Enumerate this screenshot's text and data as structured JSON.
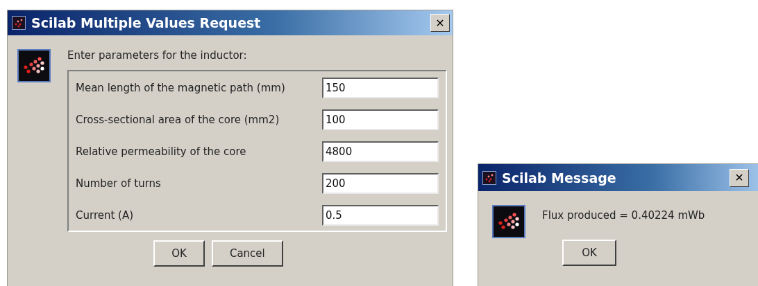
{
  "dialogs": [
    {
      "kind": "form",
      "title": "Scilab Multiple Values Request",
      "close": "✕",
      "prompt": "Enter parameters for the inductor:",
      "fields": [
        {
          "label": "Mean length of the magnetic path (mm)",
          "value": "150"
        },
        {
          "label": "Cross-sectional area of the core (mm2)",
          "value": "100"
        },
        {
          "label": "Relative permeability of the core",
          "value": "4800"
        },
        {
          "label": "Number of turns",
          "value": "200"
        },
        {
          "label": "Current (A)",
          "value": "0.5"
        }
      ],
      "buttons": [
        "OK",
        "Cancel"
      ]
    },
    {
      "kind": "message",
      "title": "Scilab Message",
      "close": "✕",
      "prompt": "Flux produced = 0.40224 mWb",
      "buttons": [
        "OK"
      ]
    }
  ]
}
